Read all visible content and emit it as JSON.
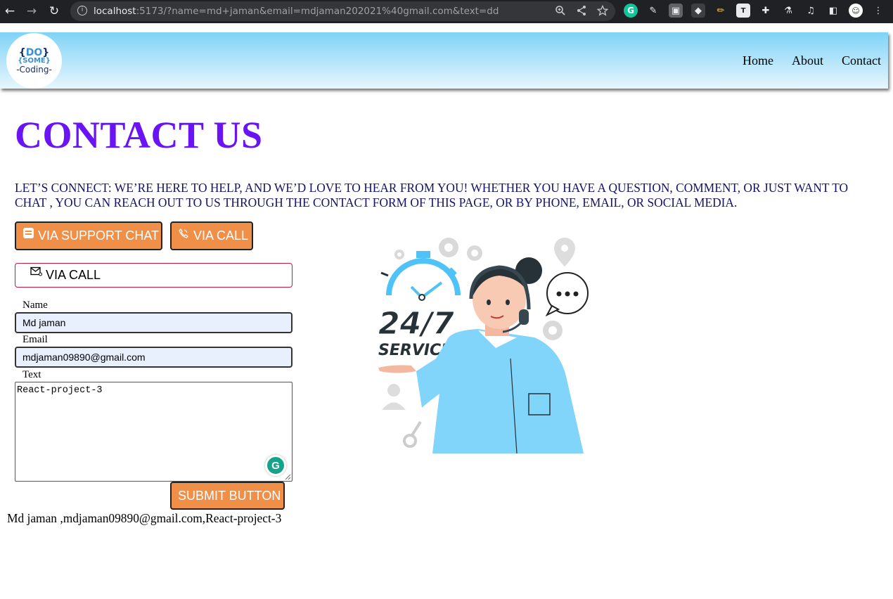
{
  "browser": {
    "back": "←",
    "forward": "→",
    "reload": "↻",
    "url_host": "localhost",
    "url_rest": ":5173/?name=md+jaman&email=mdjaman202021%40gmail.com&text=dd"
  },
  "header": {
    "logo": {
      "line1_brace_open": "{",
      "line1_do": "DO",
      "line1_brace_close": "}",
      "line2": "{SOME}",
      "line3": "-Coding-"
    },
    "nav": [
      "Home",
      "About",
      "Contact"
    ]
  },
  "main": {
    "title": "CONTACT US",
    "intro": "LET’S CONNECT: WE’RE HERE TO HELP, AND WE’D LOVE TO HEAR FROM YOU! WHETHER YOU HAVE A QUESTION, COMMENT, OR JUST WANT TO CHAT , YOU CAN REACH OUT TO US THROUGH THE CONTACT FORM OF THIS PAGE, OR BY PHONE, EMAIL, OR SOCIAL MEDIA.",
    "buttons": {
      "support_chat": "VIA SUPPORT CHAT",
      "call": "VIA CALL",
      "email_call": "VIA CALL",
      "submit": "SUBMIT BUTTON"
    },
    "form": {
      "name_label": "Name",
      "name_value": "Md jaman",
      "email_label": "Email",
      "email_value": "mdjaman09890@gmail.com",
      "text_label": "Text",
      "text_value": "React-project-3"
    },
    "output": "Md jaman ,mdjaman09890@gmail.com,React-project-3",
    "illustration": {
      "big": "24/7",
      "small": "SERVICE"
    }
  },
  "colors": {
    "accent": "#6a14f5",
    "button": "#f08f48",
    "intro_text": "#141268"
  }
}
